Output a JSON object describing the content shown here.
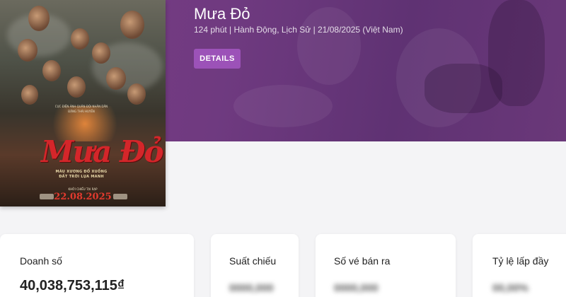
{
  "movie": {
    "title": "Mưa Đỏ",
    "meta": "124 phút  | Hành Động, Lịch Sử  | 21/08/2025 (Việt Nam)",
    "details_label": "DETAILS"
  },
  "poster": {
    "title": "Mưa Đỏ",
    "credit": "CỤC ĐIỆN ẢNH QUÂN ĐỘI NHÂN DÂN",
    "director": "ĐẶNG THÁI HUYỀN",
    "tagline_1": "MÁU XƯƠNG ĐỔ XUỐNG",
    "tagline_2": "ĐẤT TRỜI LỤA MANH",
    "release_label": "KHỞI CHIẾU TẠI RẠP",
    "release_date": "22.08.2025"
  },
  "stats": [
    {
      "label": "Doanh số",
      "value": "40,038,753,115₫",
      "hidden": false
    },
    {
      "label": "Suất chiếu",
      "value": "0000,000",
      "hidden": true
    },
    {
      "label": "Số vé bán ra",
      "value": "0000,000",
      "hidden": true
    },
    {
      "label": "Tỷ lệ lấp đầy",
      "value": "00,00%",
      "hidden": true
    }
  ],
  "colors": {
    "hero": "#6f3a80",
    "accent_button": "#9c52b8",
    "poster_title": "#d4262a"
  }
}
